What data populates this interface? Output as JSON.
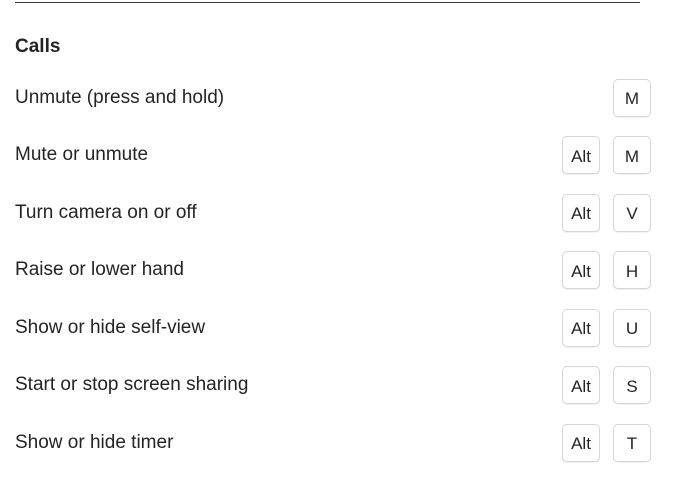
{
  "section": {
    "title": "Calls"
  },
  "shortcuts": [
    {
      "label": "Unmute (press and hold)",
      "keys": [
        "M"
      ]
    },
    {
      "label": "Mute or unmute",
      "keys": [
        "Alt",
        "M"
      ]
    },
    {
      "label": "Turn camera on or off",
      "keys": [
        "Alt",
        "V"
      ]
    },
    {
      "label": "Raise or lower hand",
      "keys": [
        "Alt",
        "H"
      ]
    },
    {
      "label": "Show or hide self-view",
      "keys": [
        "Alt",
        "U"
      ]
    },
    {
      "label": "Start or stop screen sharing",
      "keys": [
        "Alt",
        "S"
      ]
    },
    {
      "label": "Show or hide timer",
      "keys": [
        "Alt",
        "T"
      ]
    }
  ]
}
